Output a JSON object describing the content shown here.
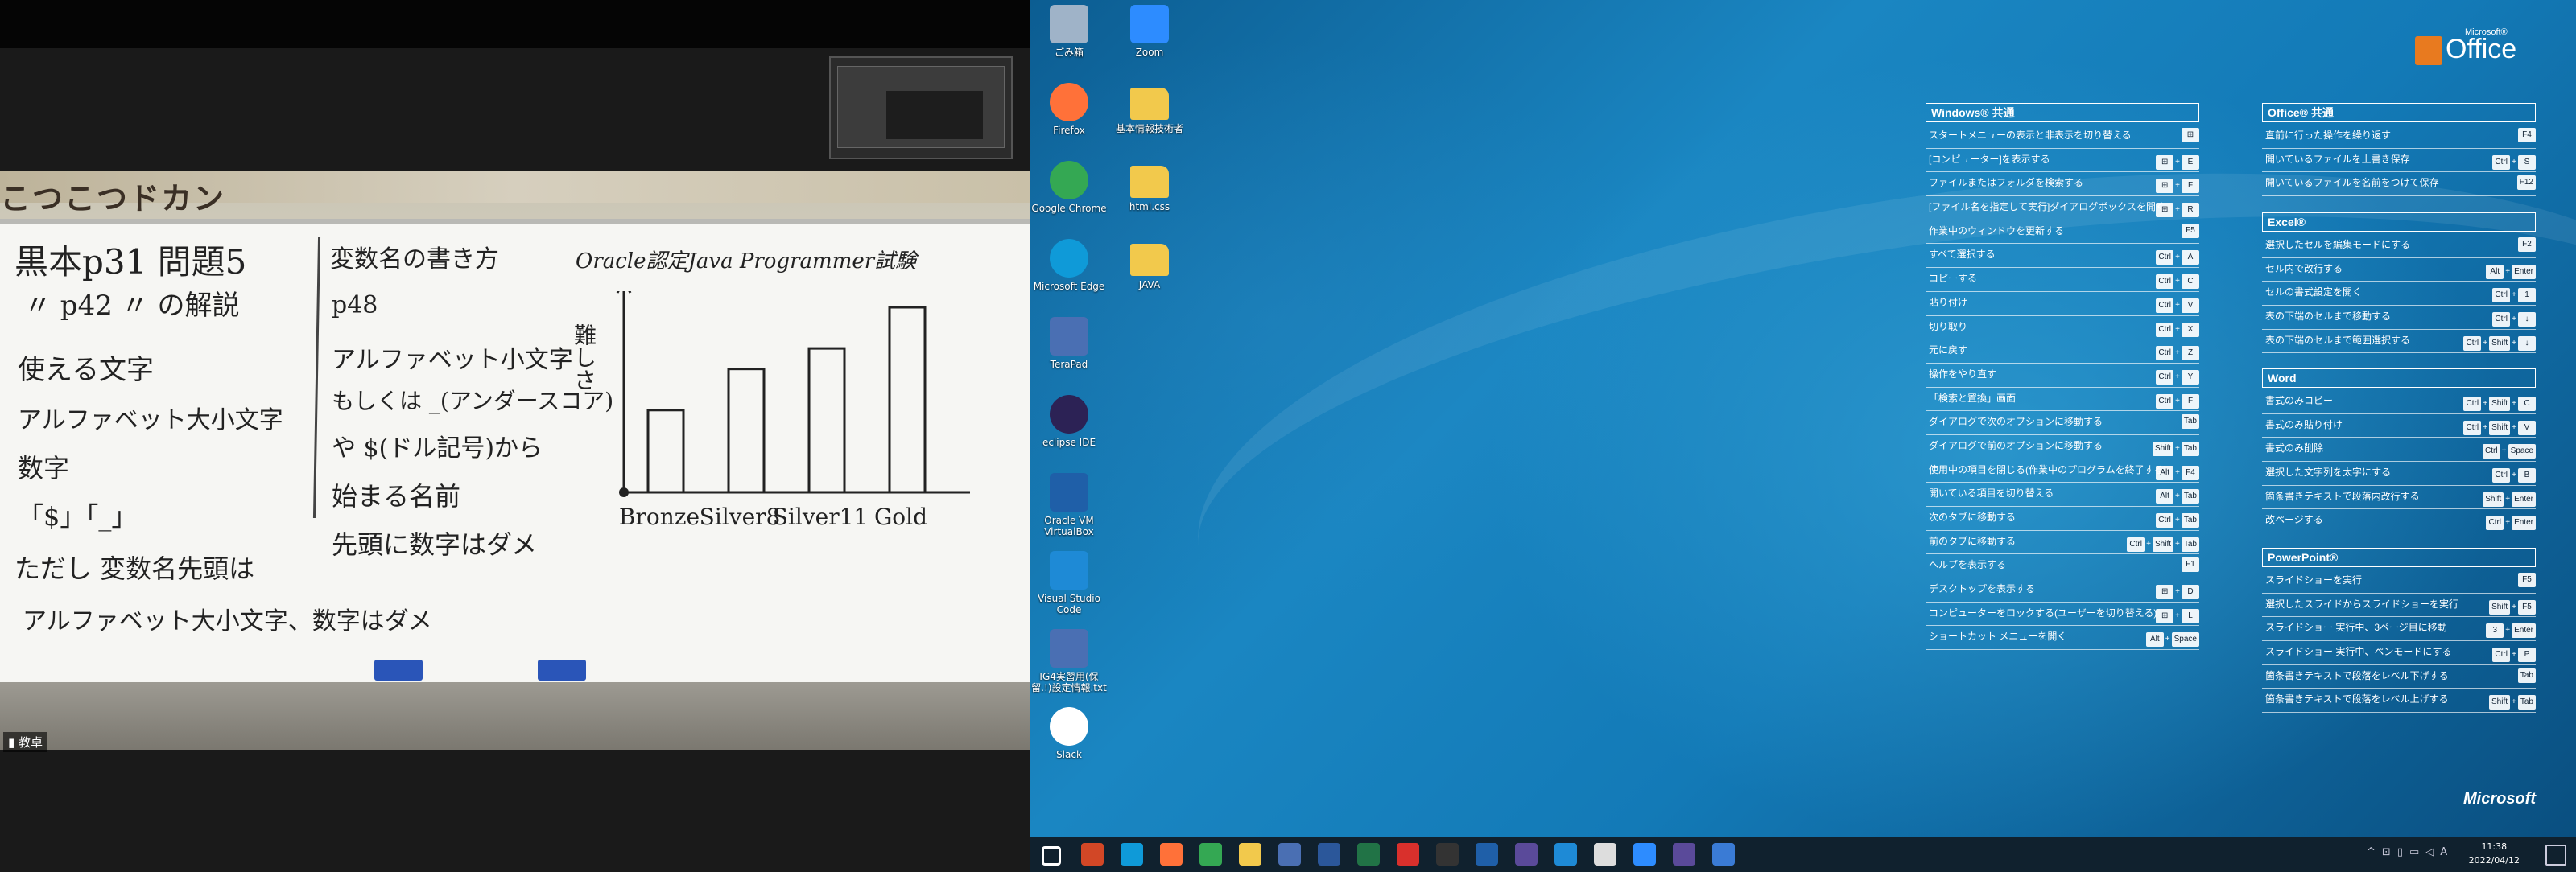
{
  "zoom": {
    "participant_label": "教卓",
    "wall_sign": "こつこつドカン",
    "whiteboard": {
      "left_lines": [
        "黒本p31 問題5",
        "〃 p42 〃 の解説",
        "使える文字",
        "アルファベット大小文字",
        "数字",
        "「$」「_」",
        "ただし 変数名先頭は",
        "アルファベット大小文字、数字はダメ"
      ],
      "middle_lines": [
        "変数名の書き方",
        "p48",
        "アルファベット小文字",
        "もしくは _(アンダースコア)",
        "や $(ドル記号)から",
        "始まる名前",
        "先頭に数字はダメ"
      ],
      "chart_title": "Oracle認定Java Programmer試験",
      "chart_ylabel": "難しさ"
    }
  },
  "chart_data": {
    "type": "bar",
    "title": "Oracle認定Java Programmer試験",
    "ylabel": "難しさ",
    "categories": [
      "Bronze",
      "Silver8",
      "Silver11",
      "Gold"
    ],
    "values": [
      2,
      3,
      3.5,
      4.5
    ],
    "ylim": [
      0,
      4.5
    ]
  },
  "desktop_icons": [
    {
      "label": "ごみ箱",
      "icon": "recycle-bin-icon",
      "color": "#9fb3c8"
    },
    {
      "label": "Zoom",
      "icon": "zoom-icon",
      "color": "#2d8cff"
    },
    {
      "label": "Firefox",
      "icon": "firefox-icon",
      "color": "#ff7139"
    },
    {
      "label": "基本情報技術者",
      "icon": "folder-icon",
      "color": "#f2c94c"
    },
    {
      "label": "Google Chrome",
      "icon": "chrome-icon",
      "color": "#34a853"
    },
    {
      "label": "html.css",
      "icon": "folder-icon",
      "color": "#f2c94c"
    },
    {
      "label": "Microsoft Edge",
      "icon": "edge-icon",
      "color": "#0f9ad8"
    },
    {
      "label": "JAVA",
      "icon": "folder-icon",
      "color": "#f2c94c"
    },
    {
      "label": "TeraPad",
      "icon": "terapad-icon",
      "color": "#4a6fb3"
    },
    {
      "label": "eclipse IDE",
      "icon": "eclipse-icon",
      "color": "#2c2255"
    },
    {
      "label": "Oracle VM VirtualBox",
      "icon": "virtualbox-icon",
      "color": "#1f5fa8"
    },
    {
      "label": "Visual Studio Code",
      "icon": "vscode-icon",
      "color": "#1e8ad6"
    },
    {
      "label": "IG4実習用(保留.!)設定情報.txt",
      "icon": "text-file-icon",
      "color": "#4a6fb3"
    },
    {
      "label": "Slack",
      "icon": "slack-icon",
      "color": "#ffffff"
    }
  ],
  "office_logo": {
    "brand": "Office",
    "small": "Microsoft®"
  },
  "ms_logo": "Microsoft",
  "panels": {
    "windows": {
      "title": "Windows® 共通",
      "rows": [
        {
          "label": "スタートメニューの表示と非表示を切り替える",
          "keys": [
            "⊞"
          ]
        },
        {
          "label": "[コンピューター]を表示する",
          "keys": [
            "⊞",
            "E"
          ]
        },
        {
          "label": "ファイルまたはフォルダを検索する",
          "keys": [
            "⊞",
            "F"
          ]
        },
        {
          "label": "[ファイル名を指定して実行]ダイアログボックスを開く",
          "keys": [
            "⊞",
            "R"
          ]
        },
        {
          "label": "作業中のウィンドウを更新する",
          "keys": [
            "F5"
          ]
        },
        {
          "label": "すべて選択する",
          "keys": [
            "Ctrl",
            "A"
          ]
        },
        {
          "label": "コピーする",
          "keys": [
            "Ctrl",
            "C"
          ]
        },
        {
          "label": "貼り付け",
          "keys": [
            "Ctrl",
            "V"
          ]
        },
        {
          "label": "切り取り",
          "keys": [
            "Ctrl",
            "X"
          ]
        },
        {
          "label": "元に戻す",
          "keys": [
            "Ctrl",
            "Z"
          ]
        },
        {
          "label": "操作をやり直す",
          "keys": [
            "Ctrl",
            "Y"
          ]
        },
        {
          "label": "「検索と置換」画面",
          "keys": [
            "Ctrl",
            "F"
          ]
        },
        {
          "label": "ダイアログで次のオプションに移動する",
          "keys": [
            "Tab"
          ]
        },
        {
          "label": "ダイアログで前のオプションに移動する",
          "keys": [
            "Shift",
            "Tab"
          ]
        },
        {
          "label": "使用中の項目を閉じる(作業中のプログラムを終了する)",
          "keys": [
            "Alt",
            "F4"
          ]
        },
        {
          "label": "開いている項目を切り替える",
          "keys": [
            "Alt",
            "Tab"
          ]
        },
        {
          "label": "次のタブに移動する",
          "keys": [
            "Ctrl",
            "Tab"
          ]
        },
        {
          "label": "前のタブに移動する",
          "keys": [
            "Ctrl",
            "Shift",
            "Tab"
          ]
        },
        {
          "label": "ヘルプを表示する",
          "keys": [
            "F1"
          ]
        },
        {
          "label": "デスクトップを表示する",
          "keys": [
            "⊞",
            "D"
          ]
        },
        {
          "label": "コンピューターをロックする(ユーザーを切り替える)",
          "keys": [
            "⊞",
            "L"
          ]
        },
        {
          "label": "ショートカット メニューを開く",
          "keys": [
            "Alt",
            "Space"
          ]
        }
      ]
    },
    "office": {
      "title": "Office® 共通",
      "rows": [
        {
          "label": "直前に行った操作を繰り返す",
          "keys": [
            "F4"
          ]
        },
        {
          "label": "開いているファイルを上書き保存",
          "keys": [
            "Ctrl",
            "S"
          ]
        },
        {
          "label": "開いているファイルを名前をつけて保存",
          "keys": [
            "F12"
          ]
        }
      ]
    },
    "excel": {
      "title": "Excel®",
      "rows": [
        {
          "label": "選択したセルを編集モードにする",
          "keys": [
            "F2"
          ]
        },
        {
          "label": "セル内で改行する",
          "keys": [
            "Alt",
            "Enter"
          ]
        },
        {
          "label": "セルの書式設定を開く",
          "keys": [
            "Ctrl",
            "1"
          ]
        },
        {
          "label": "表の下端のセルまで移動する",
          "keys": [
            "Ctrl",
            "↓"
          ]
        },
        {
          "label": "表の下端のセルまで範囲選択する",
          "keys": [
            "Ctrl",
            "Shift",
            "↓"
          ]
        }
      ]
    },
    "word": {
      "title": "Word",
      "rows": [
        {
          "label": "書式のみコピー",
          "keys": [
            "Ctrl",
            "Shift",
            "C"
          ]
        },
        {
          "label": "書式のみ貼り付け",
          "keys": [
            "Ctrl",
            "Shift",
            "V"
          ]
        },
        {
          "label": "書式のみ削除",
          "keys": [
            "Ctrl",
            "Space"
          ]
        },
        {
          "label": "選択した文字列を太字にする",
          "keys": [
            "Ctrl",
            "B"
          ]
        },
        {
          "label": "箇条書きテキストで段落内改行する",
          "keys": [
            "Shift",
            "Enter"
          ]
        },
        {
          "label": "改ページする",
          "keys": [
            "Ctrl",
            "Enter"
          ]
        }
      ]
    },
    "powerpoint": {
      "title": "PowerPoint®",
      "rows": [
        {
          "label": "スライドショーを実行",
          "keys": [
            "F5"
          ]
        },
        {
          "label": "選択したスライドからスライドショーを実行",
          "keys": [
            "Shift",
            "F5"
          ]
        },
        {
          "label": "スライドショー 実行中、3ページ目に移動",
          "keys": [
            "3",
            "Enter"
          ]
        },
        {
          "label": "スライドショー 実行中、ペンモードにする",
          "keys": [
            "Ctrl",
            "P"
          ]
        },
        {
          "label": "箇条書きテキストで段落をレベル下げする",
          "keys": [
            "Tab"
          ]
        },
        {
          "label": "箇条書きテキストで段落をレベル上げする",
          "keys": [
            "Shift",
            "Tab"
          ]
        }
      ]
    }
  },
  "taskbar": {
    "apps": [
      {
        "name": "start-icon",
        "color": "#ffffff"
      },
      {
        "name": "powerpoint-icon",
        "color": "#d24726"
      },
      {
        "name": "edge-icon",
        "color": "#0f9ad8"
      },
      {
        "name": "firefox-icon",
        "color": "#ff7139"
      },
      {
        "name": "chrome-icon",
        "color": "#34a853"
      },
      {
        "name": "file-explorer-icon",
        "color": "#f2c94c"
      },
      {
        "name": "terapad-icon",
        "color": "#4a6fb3"
      },
      {
        "name": "word-icon",
        "color": "#2b579a"
      },
      {
        "name": "excel-icon",
        "color": "#217346"
      },
      {
        "name": "acrobat-icon",
        "color": "#d9302c"
      },
      {
        "name": "terminal-icon",
        "color": "#333333"
      },
      {
        "name": "virtualbox-icon",
        "color": "#1f5fa8"
      },
      {
        "name": "eclipse-icon",
        "color": "#5a4a9a"
      },
      {
        "name": "vscode-icon",
        "color": "#1e8ad6"
      },
      {
        "name": "chrome-alt-icon",
        "color": "#dddddd"
      },
      {
        "name": "zoom-icon",
        "color": "#2d8cff"
      },
      {
        "name": "eclipse-alt-icon",
        "color": "#5a4a9a"
      },
      {
        "name": "photos-icon",
        "color": "#3a7bd5"
      }
    ],
    "time": "11:38",
    "date": "2022/04/12",
    "ime": "A"
  }
}
